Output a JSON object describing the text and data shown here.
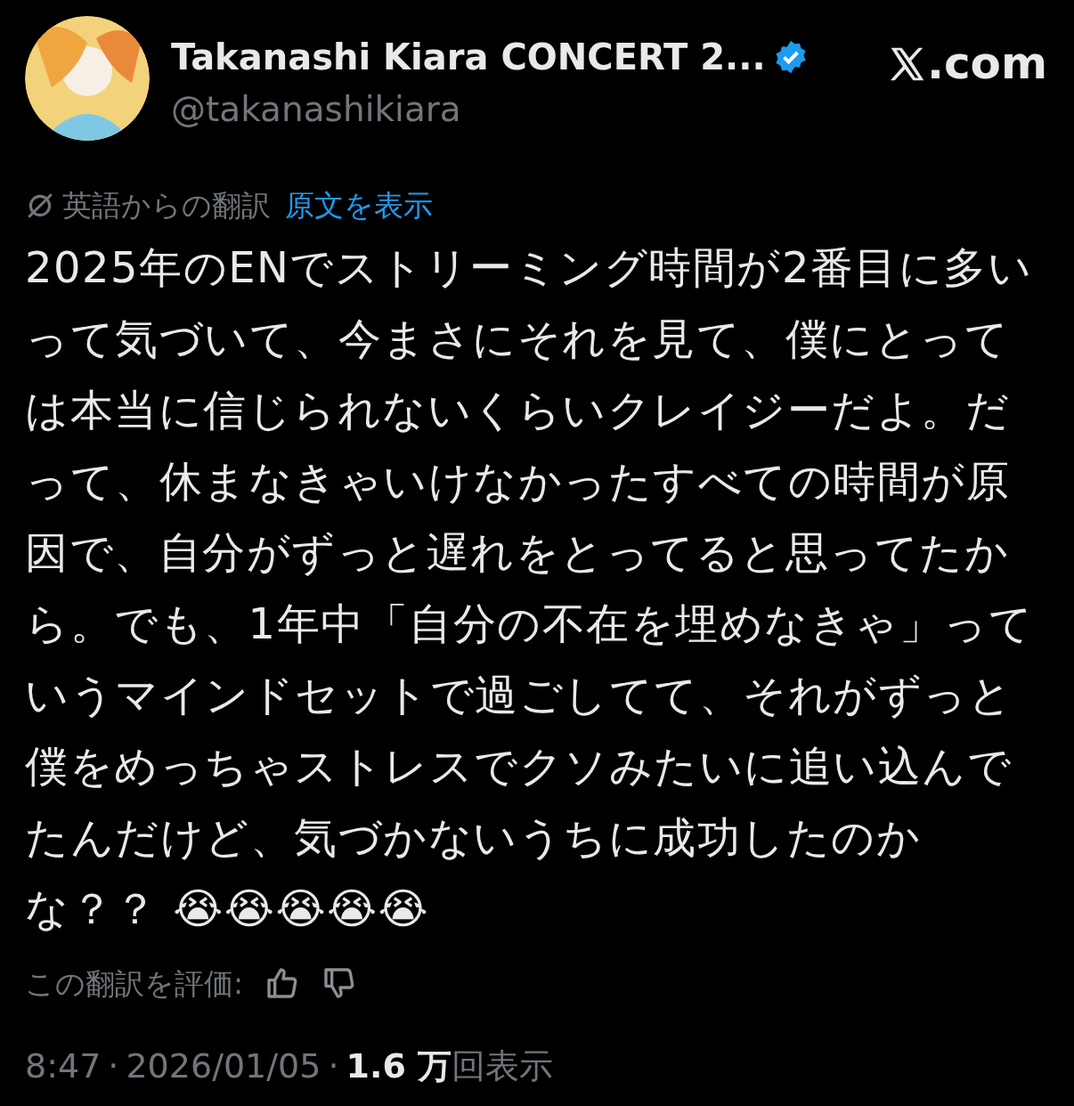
{
  "author": {
    "name": "Takanashi Kiara CONCERT 2...",
    "verified": true,
    "handle": "@takanashikiara"
  },
  "site": {
    "domain": ".com"
  },
  "translation": {
    "label": "英語からの翻訳",
    "link": "原文を表示"
  },
  "tweet": {
    "text": "2025年のENでストリーミング時間が2番目に多いって気づいて、今まさにそれを見て、僕にとっては本当に信じられないくらいクレイジーだよ。だって、休まなきゃいけなかったすべての時間が原因で、自分がずっと遅れをとってると思ってたから。でも、1年中「自分の不在を埋めなきゃ」っていうマインドセットで過ごしてて、それがずっと僕をめっちゃストレスでクソみたいに追い込んでたんだけど、気づかないうちに成功したのかな？？ 😭😭😭😭😭"
  },
  "rating": {
    "label": "この翻訳を評価:"
  },
  "meta": {
    "time": "8:47",
    "sep1": "·",
    "date": "2026/01/05",
    "sep2": "·",
    "views": "1.6 万",
    "views_label": "回表示"
  }
}
